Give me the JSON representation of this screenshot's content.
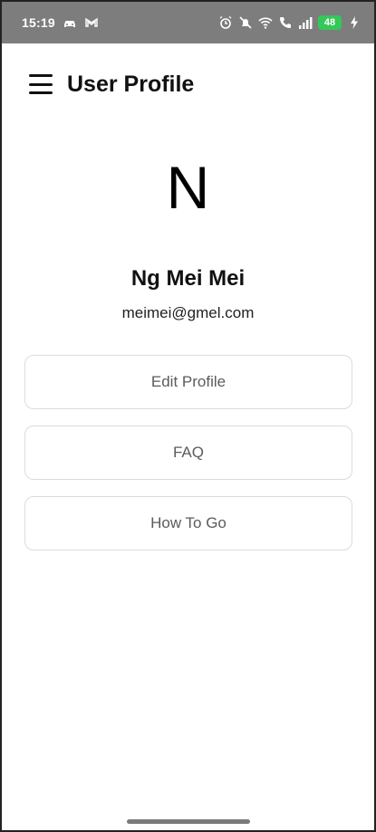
{
  "status_bar": {
    "time": "15:19",
    "battery_level": "48",
    "icons": [
      "car-icon",
      "mail-icon",
      "alarm-icon",
      "mute-icon",
      "wifi-icon",
      "call-icon",
      "signal-icon",
      "battery-icon",
      "charging-icon"
    ],
    "background_color": "#7d7d7d",
    "battery_color": "#34c759"
  },
  "app_bar": {
    "title": "User Profile",
    "menu_icon": "hamburger-menu-icon"
  },
  "profile": {
    "avatar_initial": "N",
    "name": "Ng Mei Mei",
    "email": "meimei@gmel.com"
  },
  "actions": [
    {
      "label": "Edit Profile"
    },
    {
      "label": "FAQ"
    },
    {
      "label": "How To Go"
    }
  ]
}
